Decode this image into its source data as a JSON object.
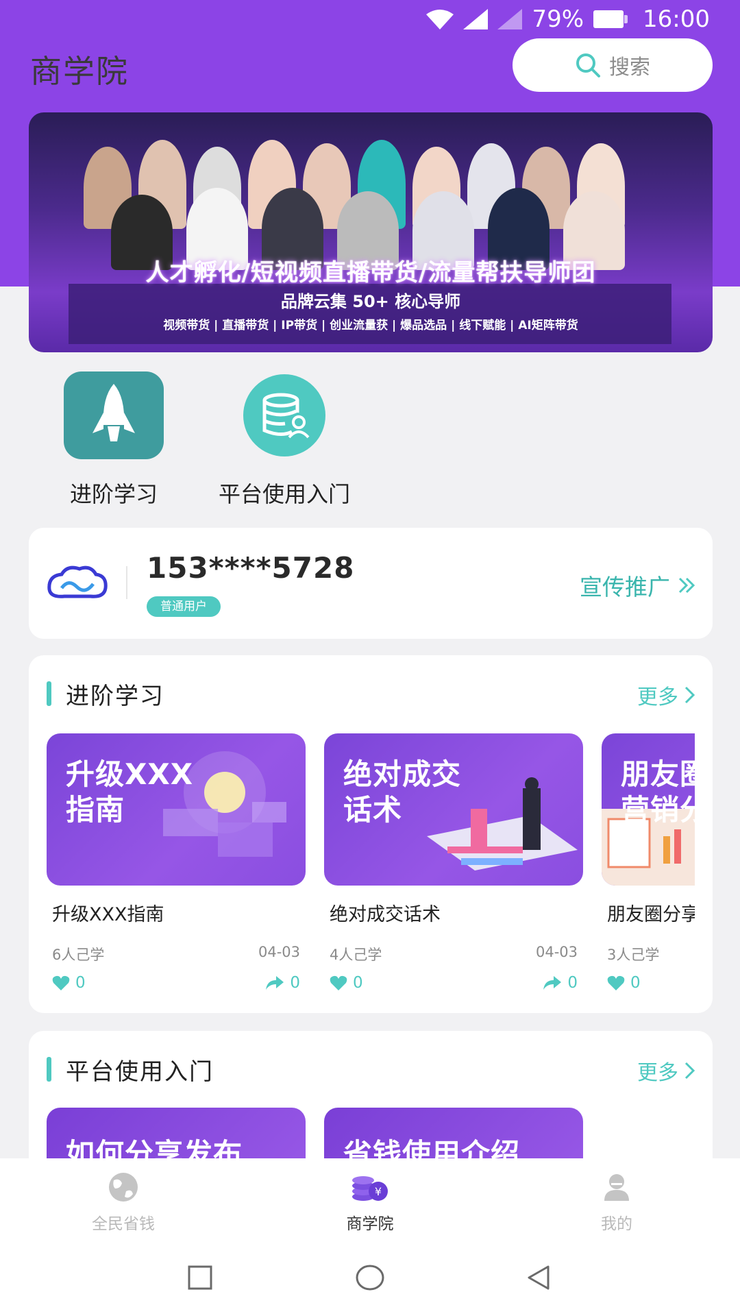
{
  "status_bar": {
    "battery": "79%",
    "time": "16:00"
  },
  "header": {
    "title": "商学院",
    "search_placeholder": "搜索"
  },
  "banner": {
    "headline": "人才孵化/短视频直播带货/流量帮扶导师团",
    "subline": "品牌云集 50+ 核心导师",
    "tags": "视频带货 | 直播带货 | IP带货 | 创业流量获 | 爆品选品 | 线下赋能 | AI矩阵带货"
  },
  "quick_nav": [
    {
      "label": "进阶学习",
      "icon": "rocket-icon"
    },
    {
      "label": "平台使用入门",
      "icon": "database-user-icon"
    }
  ],
  "user": {
    "phone": "153****5728",
    "badge": "普通用户",
    "promo": "宣传推广"
  },
  "sections": {
    "learn": {
      "title": "进阶学习",
      "more": "更多",
      "courses": [
        {
          "thumb_text": "升级XXX\n指南",
          "name": "升级XXX指南",
          "learners": "6人己学",
          "date": "04-03",
          "likes": "0",
          "shares": "0"
        },
        {
          "thumb_text": "绝对成交\n话术",
          "name": "绝对成交话术",
          "learners": "4人己学",
          "date": "04-03",
          "likes": "0",
          "shares": "0"
        },
        {
          "thumb_text": "朋友圈\n营销分",
          "name": "朋友圈分享",
          "learners": "3人己学",
          "date": "",
          "likes": "0",
          "shares": ""
        }
      ]
    },
    "platform": {
      "title": "平台使用入门",
      "more": "更多",
      "courses": [
        {
          "thumb_text": "如何分享发布"
        },
        {
          "thumb_text": "省钱使用介绍"
        }
      ]
    }
  },
  "bottom_nav": [
    {
      "label": "全民省钱",
      "icon": "globe-icon",
      "active": false
    },
    {
      "label": "商学院",
      "icon": "coins-icon",
      "active": true
    },
    {
      "label": "我的",
      "icon": "user-icon",
      "active": false
    }
  ],
  "colors": {
    "primary": "#8c44e6",
    "accent": "#4fc9c1",
    "background": "#f1f1f3"
  }
}
